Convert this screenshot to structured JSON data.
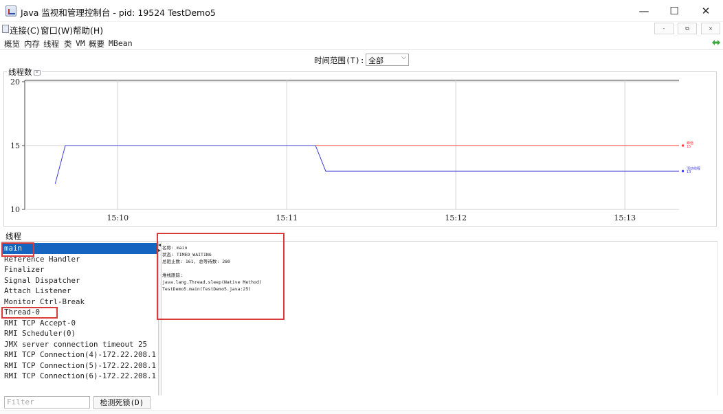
{
  "window": {
    "title": "Java 监视和管理控制台 - pid: 19524 TestDemo5",
    "minimize_glyph": "—",
    "maximize_glyph": "☐",
    "close_glyph": "✕"
  },
  "menubar": {
    "items": [
      "连接(C)",
      "窗口(W)",
      "帮助(H)"
    ],
    "mdi_buttons": [
      "‐",
      "⧉",
      "×"
    ]
  },
  "tabs": [
    "概览",
    "内存",
    "线程",
    "类",
    "VM",
    "概要",
    "MBean"
  ],
  "active_tab": "线程",
  "range": {
    "label": "时间范围(T):",
    "value": "全部"
  },
  "chart_caption": "线程数",
  "chart_data": {
    "type": "line",
    "title": "线程数",
    "xlabel": "",
    "ylabel": "",
    "ylim": [
      10,
      20
    ],
    "y_ticks": [
      "20",
      "15",
      "10"
    ],
    "x_ticks": [
      "15:10",
      "15:11",
      "15:12",
      "15:13"
    ],
    "series": [
      {
        "name": "峰值",
        "color": "#ff3b3b",
        "points": [
          [
            "15:11.17",
            15
          ],
          [
            "15:13.32",
            15
          ]
        ],
        "label_value": "15"
      },
      {
        "name": "活动线程",
        "color": "#3b3bd6",
        "points": [
          [
            "15:09.63",
            12
          ],
          [
            "15:09.69",
            15
          ],
          [
            "15:11.17",
            15
          ],
          [
            "15:11.23",
            13
          ],
          [
            "15:13.32",
            13
          ]
        ],
        "label_value": "13"
      }
    ],
    "grid": true
  },
  "threads_caption": "线程",
  "threads": [
    "main",
    "Reference Handler",
    "Finalizer",
    "Signal Dispatcher",
    "Attach Listener",
    "Monitor Ctrl-Break",
    "Thread-0",
    "RMI TCP Accept-0",
    "RMI Scheduler(0)",
    "JMX server connection timeout 25",
    "RMI TCP Connection(4)-172.22.208.1",
    "RMI TCP Connection(5)-172.22.208.1",
    "RMI TCP Connection(6)-172.22.208.1"
  ],
  "selected_thread": "main",
  "detail": {
    "name_line": "名称: main",
    "state_line": "状态: TIMED_WAITING",
    "count_line": "总阻止数: 161, 总等待数: 280",
    "stack_heading": "堆栈跟踪:",
    "stack": [
      "java.lang.Thread.sleep(Native Method)",
      "TestDemo5.main(TestDemo5.java:25)"
    ]
  },
  "filter_placeholder": "Filter",
  "deadlock_button": "检测死锁(D)",
  "colors": {
    "selection": "#1565c0",
    "annotation_red": "#d93a3a",
    "peak_line": "#ff3b3b",
    "live_line": "#3b3bd6"
  }
}
